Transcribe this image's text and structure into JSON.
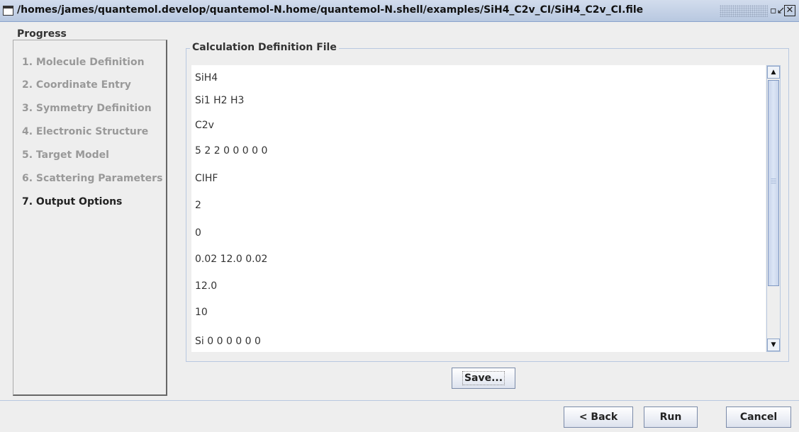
{
  "window": {
    "title": "/homes/james/quantemol.develop/quantemol-N.home/quantemol-N.shell/examples/SiH4_C2v_CI/SiH4_C2v_CI.file",
    "restore_glyph": "▫↙",
    "close_glyph": "✕"
  },
  "progress": {
    "title": "Progress",
    "steps": [
      {
        "label": "1. Molecule Definition"
      },
      {
        "label": "2. Coordinate Entry"
      },
      {
        "label": "3. Symmetry Definition"
      },
      {
        "label": "4. Electronic Structure"
      },
      {
        "label": "5. Target Model"
      },
      {
        "label": "6. Scattering Parameters"
      },
      {
        "label": "7. Output Options",
        "current": true
      }
    ]
  },
  "file_panel": {
    "title": "Calculation Definition File",
    "lines": [
      "SiH4",
      "Si1 H2 H3",
      "C2v",
      "5 2 2 0 0 0 0 0",
      "CIHF",
      "2",
      "0",
      "0.02 12.0 0.02",
      "12.0",
      "10",
      "Si 0 0 0 0 0 0"
    ],
    "save_label": "Save..."
  },
  "footer": {
    "back_label": "< Back",
    "run_label": "Run",
    "cancel_label": "Cancel"
  },
  "icons": {
    "scroll_up": "arrow-up-icon",
    "scroll_down": "arrow-down-icon",
    "window": "window-icon"
  }
}
